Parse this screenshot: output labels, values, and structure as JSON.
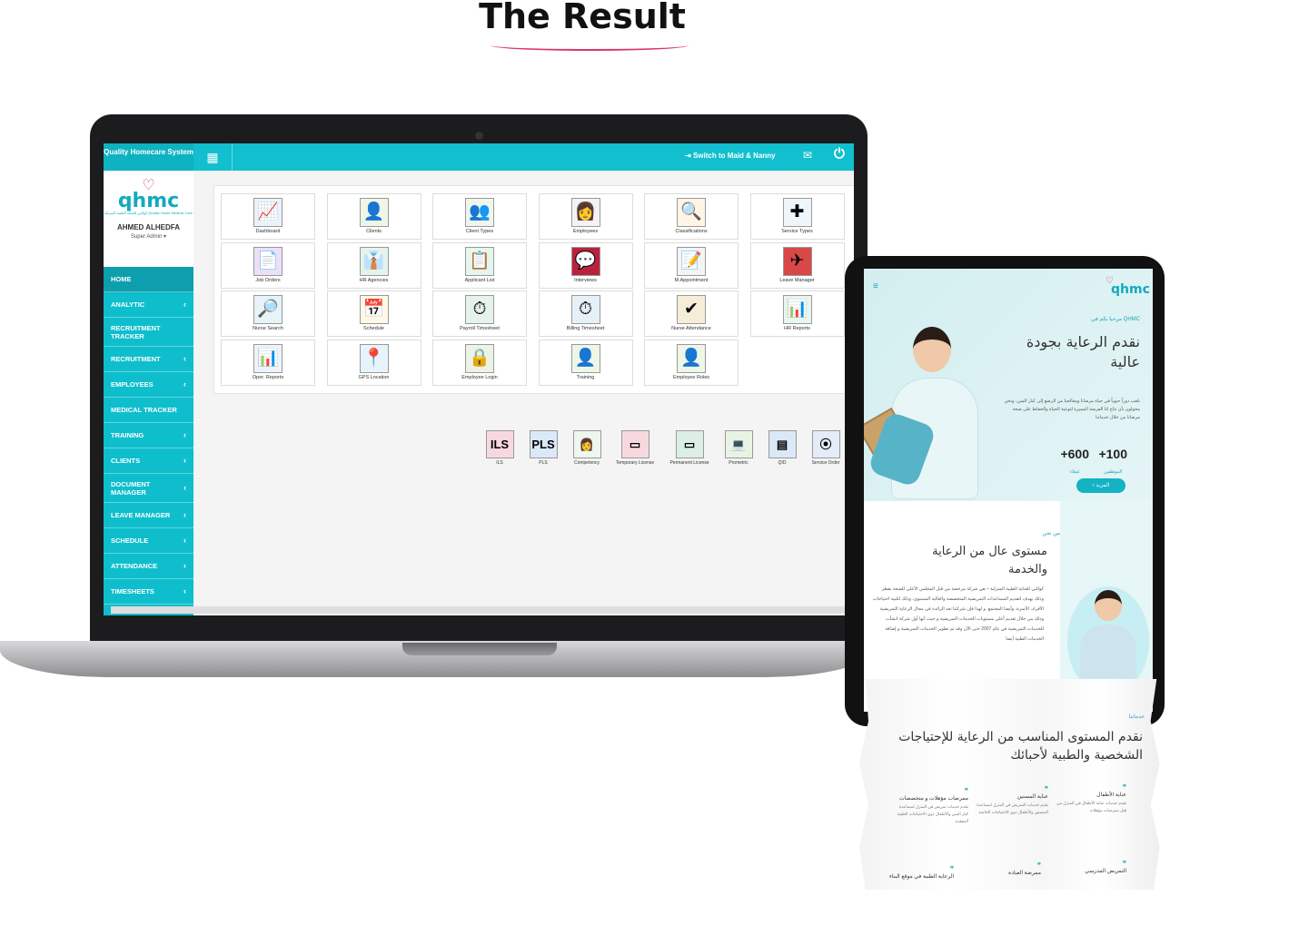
{
  "page_title": "The Result",
  "app": {
    "brand": "Quality Homecare System",
    "switch_label": "Switch to Maid & Nanny",
    "logo": "qhmc",
    "logo_sub": "كوالتي للعناية الطبية المنزلية Quality Home Medical Care",
    "user_name": "AHMED ALHEDFA",
    "user_role": "Super Admin",
    "nav": [
      {
        "label": "HOME",
        "chevron": false
      },
      {
        "label": "ANALYTIC",
        "chevron": true
      },
      {
        "label": "RECRUITMENT TRACKER",
        "chevron": false
      },
      {
        "label": "RECRUITMENT",
        "chevron": true
      },
      {
        "label": "EMPLOYEES",
        "chevron": true
      },
      {
        "label": "MEDICAL TRACKER",
        "chevron": false
      },
      {
        "label": "TRAINING",
        "chevron": true
      },
      {
        "label": "CLIENTS",
        "chevron": true
      },
      {
        "label": "DOCUMENT MANAGER",
        "chevron": true
      },
      {
        "label": "LEAVE MANAGER",
        "chevron": true
      },
      {
        "label": "SCHEDULE",
        "chevron": true
      },
      {
        "label": "ATTENDANCE",
        "chevron": true
      },
      {
        "label": "TIMESHEETS",
        "chevron": true
      }
    ],
    "tiles": [
      {
        "label": "Dashboard",
        "icon": "chart-icon",
        "glyph": "📈",
        "color": "#e9f3fb"
      },
      {
        "label": "Clients",
        "icon": "client-icon",
        "glyph": "👤",
        "color": "#eef6e7"
      },
      {
        "label": "Client Types",
        "icon": "client-types-icon",
        "glyph": "👥",
        "color": "#eef6ee"
      },
      {
        "label": "Employees",
        "icon": "nurse-icon",
        "glyph": "👩",
        "color": "#f3f3f7"
      },
      {
        "label": "Classifications",
        "icon": "search-doc-icon",
        "glyph": "🔍",
        "color": "#fff4e6"
      },
      {
        "label": "Service Types",
        "icon": "first-aid-icon",
        "glyph": "✚",
        "color": "#eef6fb"
      },
      {
        "label": "Job Orders",
        "icon": "job-orders-icon",
        "glyph": "📄",
        "color": "#ecdff6"
      },
      {
        "label": "HR Agencies",
        "icon": "agency-icon",
        "glyph": "👔",
        "color": "#e3f4ec"
      },
      {
        "label": "Applicant List",
        "icon": "applicant-icon",
        "glyph": "📋",
        "color": "#e5f6ee"
      },
      {
        "label": "Interviews",
        "icon": "interview-icon",
        "glyph": "💬",
        "color": "#b8223d"
      },
      {
        "label": "M.Appointment",
        "icon": "appointment-icon",
        "glyph": "📝",
        "color": "#f4f4f4"
      },
      {
        "label": "Leave Manager",
        "icon": "plane-icon",
        "glyph": "✈",
        "color": "#d94747"
      },
      {
        "label": "Nurse Search",
        "icon": "nurse-search-icon",
        "glyph": "🔎",
        "color": "#e7f3f7"
      },
      {
        "label": "Schedule",
        "icon": "calendar-icon",
        "glyph": "📅",
        "color": "#fff8e5"
      },
      {
        "label": "Payroll Timesheet",
        "icon": "payroll-icon",
        "glyph": "⏱",
        "color": "#e6f3ea"
      },
      {
        "label": "Billing Timesheet",
        "icon": "billing-icon",
        "glyph": "⏱",
        "color": "#e6f0f7"
      },
      {
        "label": "Nurse Attendance",
        "icon": "attendance-icon",
        "glyph": "✔",
        "color": "#f6edd8"
      },
      {
        "label": "HR Reports",
        "icon": "hr-reports-icon",
        "glyph": "📊",
        "color": "#e8f6ec"
      },
      {
        "label": "Oper. Reports",
        "icon": "oper-reports-icon",
        "glyph": "📊",
        "color": "#eef3fb"
      },
      {
        "label": "GPS Location",
        "icon": "map-pin-icon",
        "glyph": "📍",
        "color": "#e6f3fb"
      },
      {
        "label": "Employee Login",
        "icon": "lock-icon",
        "glyph": "🔒",
        "color": "#ecf3e6"
      },
      {
        "label": "Training",
        "icon": "training-icon",
        "glyph": "👤",
        "color": "#eef6e6"
      },
      {
        "label": "Employee Roles",
        "icon": "roles-icon",
        "glyph": "👤",
        "color": "#eef6e6"
      }
    ],
    "bottom_icons": [
      {
        "label": "ILS",
        "icon": "ils-icon",
        "glyph": "ILS",
        "color": "#f8d8df"
      },
      {
        "label": "PLS",
        "icon": "pls-icon",
        "glyph": "PLS",
        "color": "#dbe8f8"
      },
      {
        "label": "Competency",
        "icon": "competency-icon",
        "glyph": "👩",
        "color": "#eef6ee"
      },
      {
        "label": "Temporary License",
        "icon": "temp-license-icon",
        "glyph": "▭",
        "color": "#f8d8df"
      },
      {
        "label": "Permanent License",
        "icon": "perm-license-icon",
        "glyph": "▭",
        "color": "#dcefe5"
      },
      {
        "label": "Prometric",
        "icon": "prometric-icon",
        "glyph": "💻",
        "color": "#e8f3e4"
      },
      {
        "label": "QID",
        "icon": "qid-icon",
        "glyph": "▤",
        "color": "#dbe8f8"
      },
      {
        "label": "Service Order",
        "icon": "service-order-icon",
        "glyph": "⦿",
        "color": "#e4ecf8"
      }
    ]
  },
  "tablet": {
    "logo": "qhmc",
    "welcome": "مرحبا بكم في QHMC",
    "hero_title": "نقدم الرعاية بجودة عالية",
    "hero_text": "نلعب دوراً حيوياً في حياة مرضانا ومعالجنا من الرضع إلى كبار السن، ونحن مخولون بأن نتاح لنا الفرصة المميزة لتوعية الحياة والحفاظ على صحة مرضانا من خلال خدماتنا",
    "stats": [
      {
        "value": "+100",
        "label": "الموظفين"
      },
      {
        "value": "+600",
        "label": "عملاء"
      }
    ],
    "more_label": "المزيد",
    "about_tag": "من نحن",
    "about_title": "مستوى عال من الرعاية والخدمة",
    "about_text": "كوالتي للعناية الطبية المنزلية – هي شركة مرخصة من قبل المجلس الأعلى للصحة بقطر وذلك بهدف لتقديم المساعدات التمريضية المتخصصة والعالية المستوى، وذلك لتلبية احتياجات الأفراد، الأسرة، وأيضا المجتمع. و لهذا فإن شركتنا تعد الرائدة في مجال الرعاية التمريضية وذلك من خلال تقديم أعلى مستويات الخدمات التمريضية و حيث أنها أول شركة انشأت للخدمات التمريضية في عام 2007 حتى الآن وقد تم تطوير الخدمات التمريضية و إضافة الخدمات الطبية أيضا",
    "services_tag": "خدماتنا",
    "services_title": "نقدم المستوى المناسب من الرعاية للإحتياجات الشخصية والطبية لأحبائك",
    "services": [
      {
        "title": "عناية الأطفال",
        "desc": "نقدم خدمات عناية الأطفال في المنزل من قبل ممرضات مؤهلات"
      },
      {
        "title": "عناية المسنين",
        "desc": "نقدم خدمات التمريض في المنزل لمساعدة المسنين والأطفال ذوي الاحتياجات الخاصة"
      },
      {
        "title": "ممرضات مؤهلات و متخصصات",
        "desc": "نقدم خدمات تمريض في المنزل لمساعدة كبار السن والأطفال ذوي الاحتياجات الطبية المعقدة"
      },
      {
        "title": "التمريض المدرسي",
        "desc": ""
      },
      {
        "title": "ممرضة العيادة",
        "desc": ""
      },
      {
        "title": "الرعاية الطبية في موقع البناء",
        "desc": ""
      }
    ]
  },
  "colors": {
    "accent": "#11bfcf",
    "brand_pink": "#d93764",
    "sidebar": "#0fbecd"
  }
}
